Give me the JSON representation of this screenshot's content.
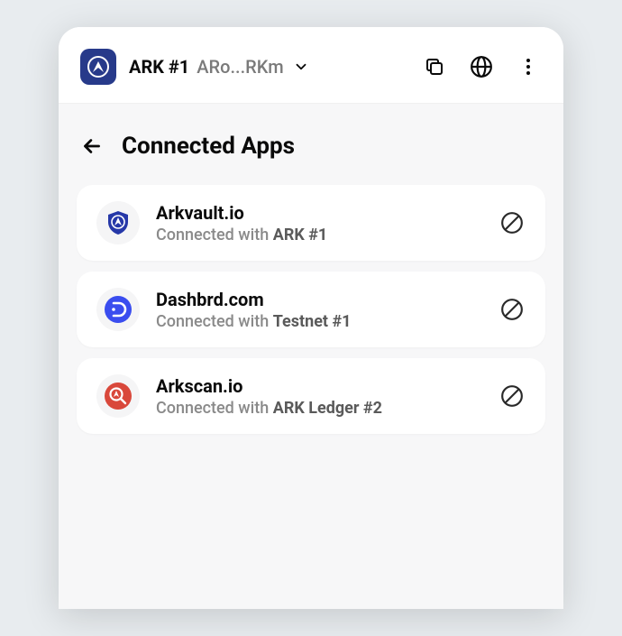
{
  "header": {
    "wallet_name": "ARK #1",
    "wallet_address_short": "ARo...RKm"
  },
  "page": {
    "title": "Connected Apps"
  },
  "apps": [
    {
      "name": "Arkvault.io",
      "connected_prefix": "Connected with ",
      "connected_wallet": "ARK #1",
      "icon": "arkvault",
      "icon_bg": "#2638a8",
      "icon_fg": "#ffffff"
    },
    {
      "name": "Dashbrd.com",
      "connected_prefix": "Connected with ",
      "connected_wallet": "Testnet #1",
      "icon": "dashbrd",
      "icon_bg": "#3a4def",
      "icon_fg": "#ffffff"
    },
    {
      "name": "Arkscan.io",
      "connected_prefix": "Connected with ",
      "connected_wallet": "ARK Ledger #2",
      "icon": "arkscan",
      "icon_bg": "#d9483b",
      "icon_fg": "#ffffff"
    }
  ]
}
